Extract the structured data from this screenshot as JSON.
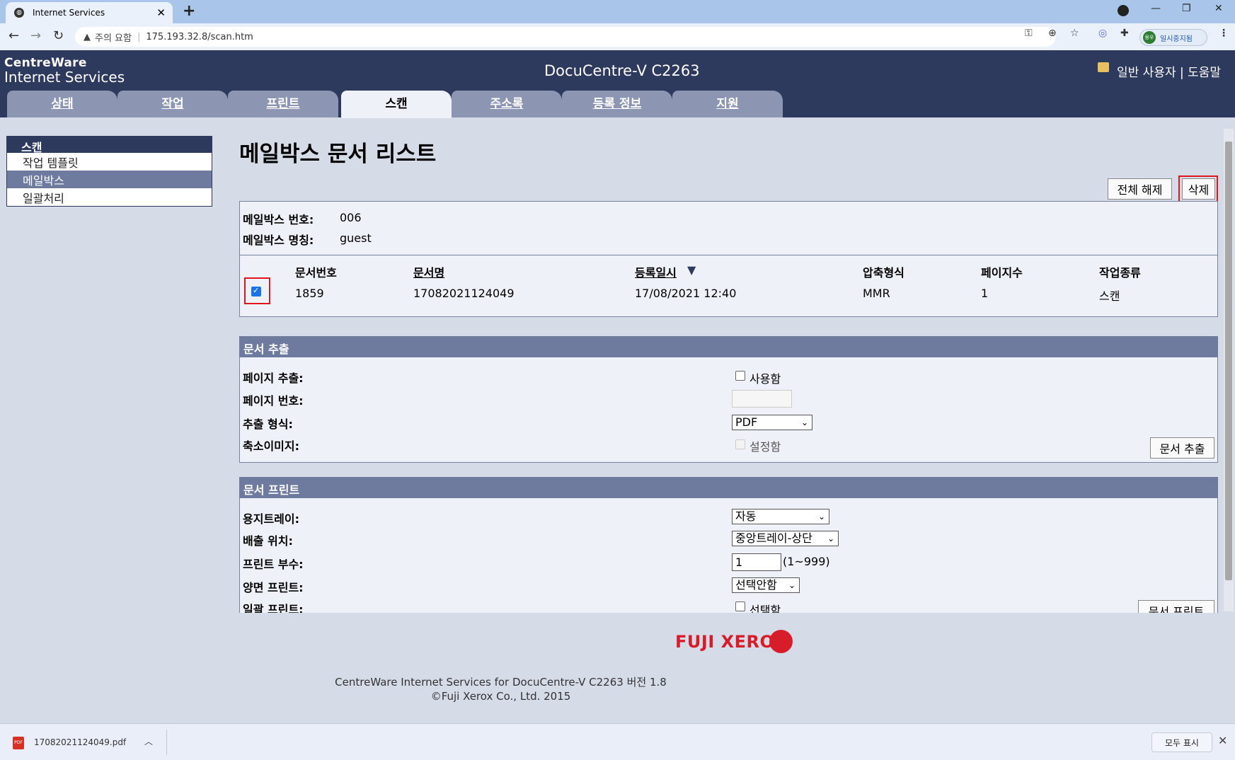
{
  "browser": {
    "tab_title": "Internet Services",
    "new_tab": "+",
    "window": {
      "minimize": "—",
      "restore": "❐",
      "close": "✕"
    },
    "security_label": "주의 요함",
    "url": "175.193.32.8/scan.htm",
    "profile_label": "일시중지됨",
    "profile_avatar": "용우"
  },
  "header": {
    "brand_line1": "CentreWare",
    "brand_line2": "Internet Services",
    "device": "DocuCentre-V C2263",
    "user_links": "일반 사용자 | 도움말"
  },
  "nav_tabs": [
    {
      "label": "상태"
    },
    {
      "label": "작업"
    },
    {
      "label": "프린트"
    },
    {
      "label": "스캔"
    },
    {
      "label": "주소록"
    },
    {
      "label": "등록 정보"
    },
    {
      "label": "지원"
    }
  ],
  "sidebar": {
    "header": "스캔",
    "items": [
      {
        "label": "작업 템플릿"
      },
      {
        "label": "메일박스"
      },
      {
        "label": "일괄처리"
      }
    ]
  },
  "page_title": "메일박스 문서 리스트",
  "actions": {
    "deselect_all": "전체 해제",
    "delete": "삭제"
  },
  "mailbox": {
    "number_label": "메일박스 번호:",
    "number": "006",
    "name_label": "메일박스 명칭:",
    "name": "guest"
  },
  "doc_table": {
    "columns": [
      "문서번호",
      "문서명",
      "등록일시",
      "압축형식",
      "페이지수",
      "작업종류"
    ],
    "sort_indicator": "▼",
    "rows": [
      {
        "number": "1859",
        "name": "17082021124049",
        "date": "17/08/2021 12:40",
        "compression": "MMR",
        "pages": "1",
        "job_type": "스캔"
      }
    ]
  },
  "extract": {
    "section_title": "문서 추출",
    "page_extract_label": "페이지 추출:",
    "page_extract_option": "사용함",
    "page_number_label": "페이지 번호:",
    "page_number_value": "",
    "format_label": "추출 형식:",
    "format_value": "PDF",
    "thumbnail_label": "축소이미지:",
    "thumbnail_option": "설정함",
    "extract_button": "문서 추출"
  },
  "print": {
    "section_title": "문서 프린트",
    "tray_label": "용지트레이:",
    "tray_value": "자동",
    "output_label": "배출 위치:",
    "output_value": "중앙트레이-상단",
    "copies_label": "프린트 부수:",
    "copies_value": "1",
    "copies_range": "(1~999)",
    "duplex_label": "양면 프린트:",
    "duplex_value": "선택안함",
    "batch_label": "일괄 프린트:",
    "batch_option": "선택함",
    "print_button": "문서 프린트"
  },
  "footer": {
    "logo": "FUJI XEROX",
    "line1": "CentreWare Internet Services for DocuCentre-V C2263 버전 1.8",
    "line2": "©Fuji Xerox Co., Ltd. 2015"
  },
  "download_bar": {
    "file_name": "17082021124049.pdf",
    "file_type": "PDF",
    "show_all": "모두 표시"
  }
}
